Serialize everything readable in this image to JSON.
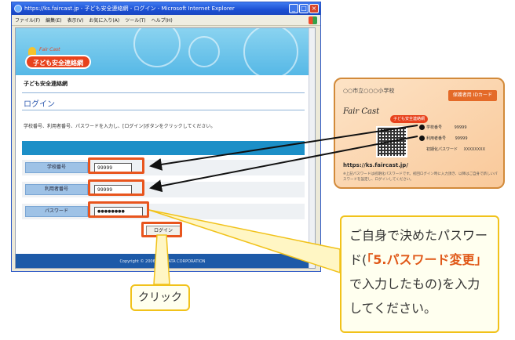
{
  "window": {
    "title": "https://ks.faircast.jp - 子ども安全連絡網 - ログイン - Microsoft Internet Explorer",
    "menu": [
      "ファイル(F)",
      "編集(E)",
      "表示(V)",
      "お気に入り(A)",
      "ツール(T)",
      "ヘルプ(H)"
    ]
  },
  "page": {
    "logo_text": "子ども安全連絡網",
    "logo_small": "Fair Cast",
    "site_name": "子ども安全連絡網",
    "heading": "ログイン",
    "instruction": "学校番号、利用者番号、パスワードを入力し、[ログイン]ボタンをクリックしてください。",
    "fields": [
      {
        "label": "学校番号",
        "value": "99999"
      },
      {
        "label": "利用者番号",
        "value": "99999"
      },
      {
        "label": "パスワード",
        "value": "●●●●●●●●"
      }
    ],
    "login_button": "ログイン",
    "footer": "Copyright © 2006 NTT DATA CORPORATION"
  },
  "card": {
    "school": "○○市立○○○小学校",
    "tag": "保護者用 IDカード",
    "brand": "Fair Cast",
    "logo": "子ども安全連絡網",
    "school_no_label": "学校番号",
    "school_no": "99999",
    "user_no_label": "利用者番号",
    "user_no": "99999",
    "init_pw_label": "初期化パスワード",
    "init_pw": "XXXXXXXX",
    "url": "https://ks.faircast.jp/",
    "note": "※上記パスワードは初期化パスワードです。初回ログイン時に入力頂き、以降はご自身で新しいパスワードを設定し、ログインしてください。"
  },
  "callout": {
    "pre": "ご自身で決めたパスワード(",
    "em": "「5.パスワード変更」",
    "post": "で入力したもの)を入力してください。"
  },
  "click_label": "クリック",
  "colors": {
    "highlight": "#e8551e",
    "callout_border": "#f1c21a",
    "accent": "#e05818"
  }
}
